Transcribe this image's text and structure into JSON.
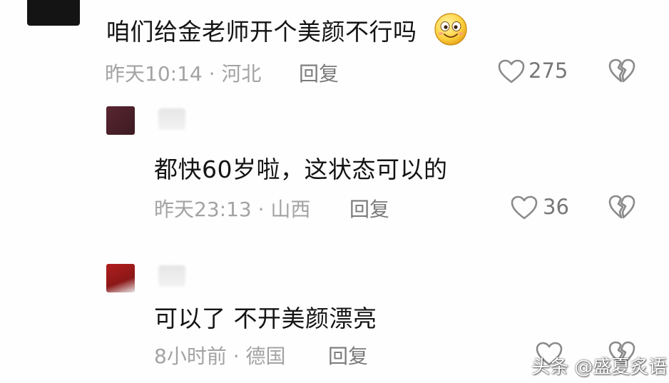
{
  "comments": [
    {
      "text": "咱们给金老师开个美颜不行吗",
      "time": "昨天10:14 · 河北",
      "reply_label": "回复",
      "likes": "275"
    },
    {
      "text": "都快60岁啦，这状态可以的",
      "time": "昨天23:13 · 山西",
      "reply_label": "回复",
      "likes": "36"
    },
    {
      "text": "可以了 不开美颜漂亮",
      "time": "8小时前 · 德国",
      "reply_label": "回复",
      "likes": ""
    }
  ],
  "watermark": "头条 @盛夏炙语",
  "colors": {
    "text": "#141414",
    "meta": "#a3a3a3",
    "icon": "#8a8a8a",
    "background": "#fefefe"
  },
  "icons": {
    "like": "heart-outline-icon",
    "dislike": "broken-heart-icon",
    "emoji": "smile-emoji-icon"
  }
}
